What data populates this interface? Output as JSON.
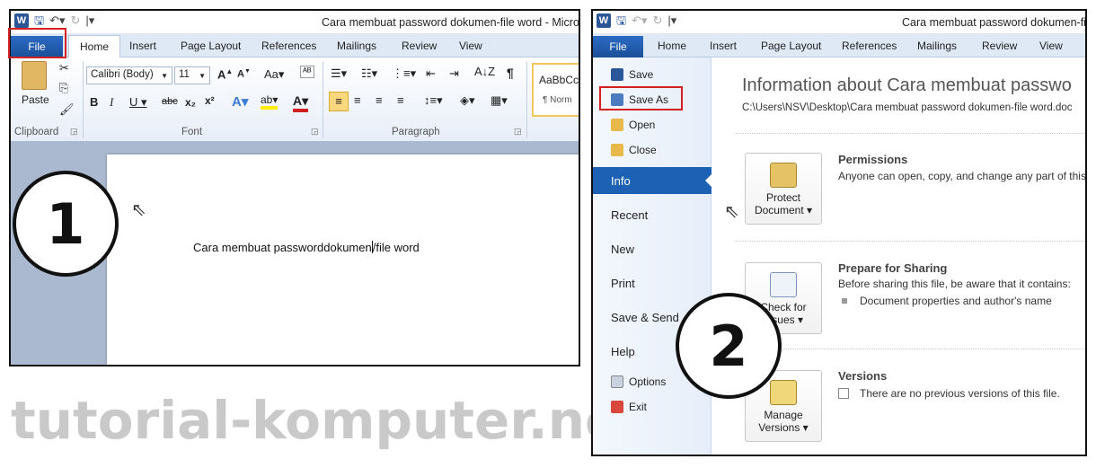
{
  "panel1": {
    "title": "Cara membuat password dokumen-file word  -  Micros",
    "tabs": [
      "File",
      "Home",
      "Insert",
      "Page Layout",
      "References",
      "Mailings",
      "Review",
      "View"
    ],
    "ribbon": {
      "paste_label": "Paste",
      "font_name": "Calibri (Body)",
      "font_size": "11",
      "style_preview": "AaBbCc",
      "style_name": "¶ Norm",
      "group_clipboard": "Clipboard",
      "group_font": "Font",
      "group_paragraph": "Paragraph"
    },
    "document_text": "Cara membuat passworddokumen",
    "document_text_after": "file word",
    "step_number": "1"
  },
  "panel2": {
    "title": "Cara membuat password dokumen-file word  -  Micros",
    "tabs": [
      "File",
      "Home",
      "Insert",
      "Page Layout",
      "References",
      "Mailings",
      "Review",
      "View"
    ],
    "menu": {
      "save": "Save",
      "save_as": "Save As",
      "open": "Open",
      "close": "Close",
      "info": "Info",
      "recent": "Recent",
      "new": "New",
      "print": "Print",
      "save_send": "Save & Send",
      "help": "Help",
      "options": "Options",
      "exit": "Exit"
    },
    "info_heading": "Information about Cara membuat passwo",
    "file_path": "C:\\Users\\NSV\\Desktop\\Cara membuat password dokumen-file word.doc",
    "protect_btn_l1": "Protect",
    "protect_btn_l2": "Document ▾",
    "permissions_title": "Permissions",
    "permissions_text": "Anyone can open, copy, and change any part of this",
    "check_btn_l1": "Check for",
    "check_btn_l2": "Issues ▾",
    "sharing_title": "Prepare for Sharing",
    "sharing_text": "Before sharing this file, be aware that it contains:",
    "sharing_bullet": "Document properties and author's name",
    "manage_btn_l1": "Manage",
    "manage_btn_l2": "Versions ▾",
    "versions_title": "Versions",
    "versions_text": "There are no previous versions of this file.",
    "step_number": "2"
  },
  "watermark": "tutorial-komputer.net",
  "colors": {
    "highlight_box": "#d42020",
    "file_tab": "#1a4f99",
    "info_selected": "#1c61b3"
  }
}
